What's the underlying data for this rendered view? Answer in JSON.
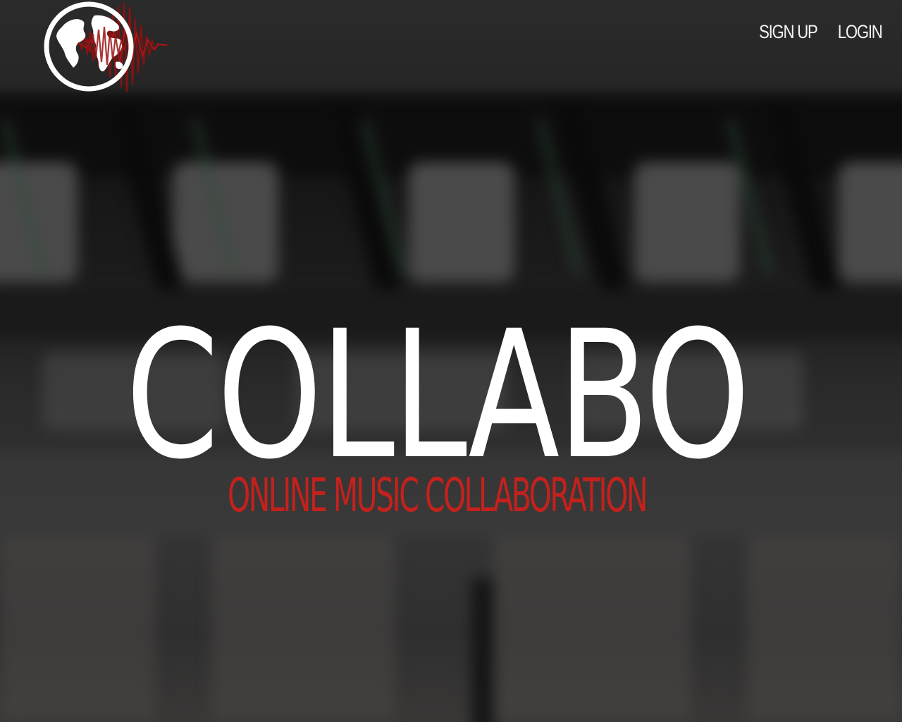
{
  "nav": {
    "signup_label": "SIGN UP",
    "login_label": "LOGIN"
  },
  "logo": {
    "icon": "globe-with-soundwave-icon"
  },
  "hero": {
    "title": "COLLABO",
    "subtitle": "ONLINE MUSIC COLLABORATION"
  },
  "colors": {
    "accent": "#c4211d",
    "title_text": "#ffffff",
    "nav_text": "#f2f2f2",
    "topbar": "#2b2b2b"
  }
}
